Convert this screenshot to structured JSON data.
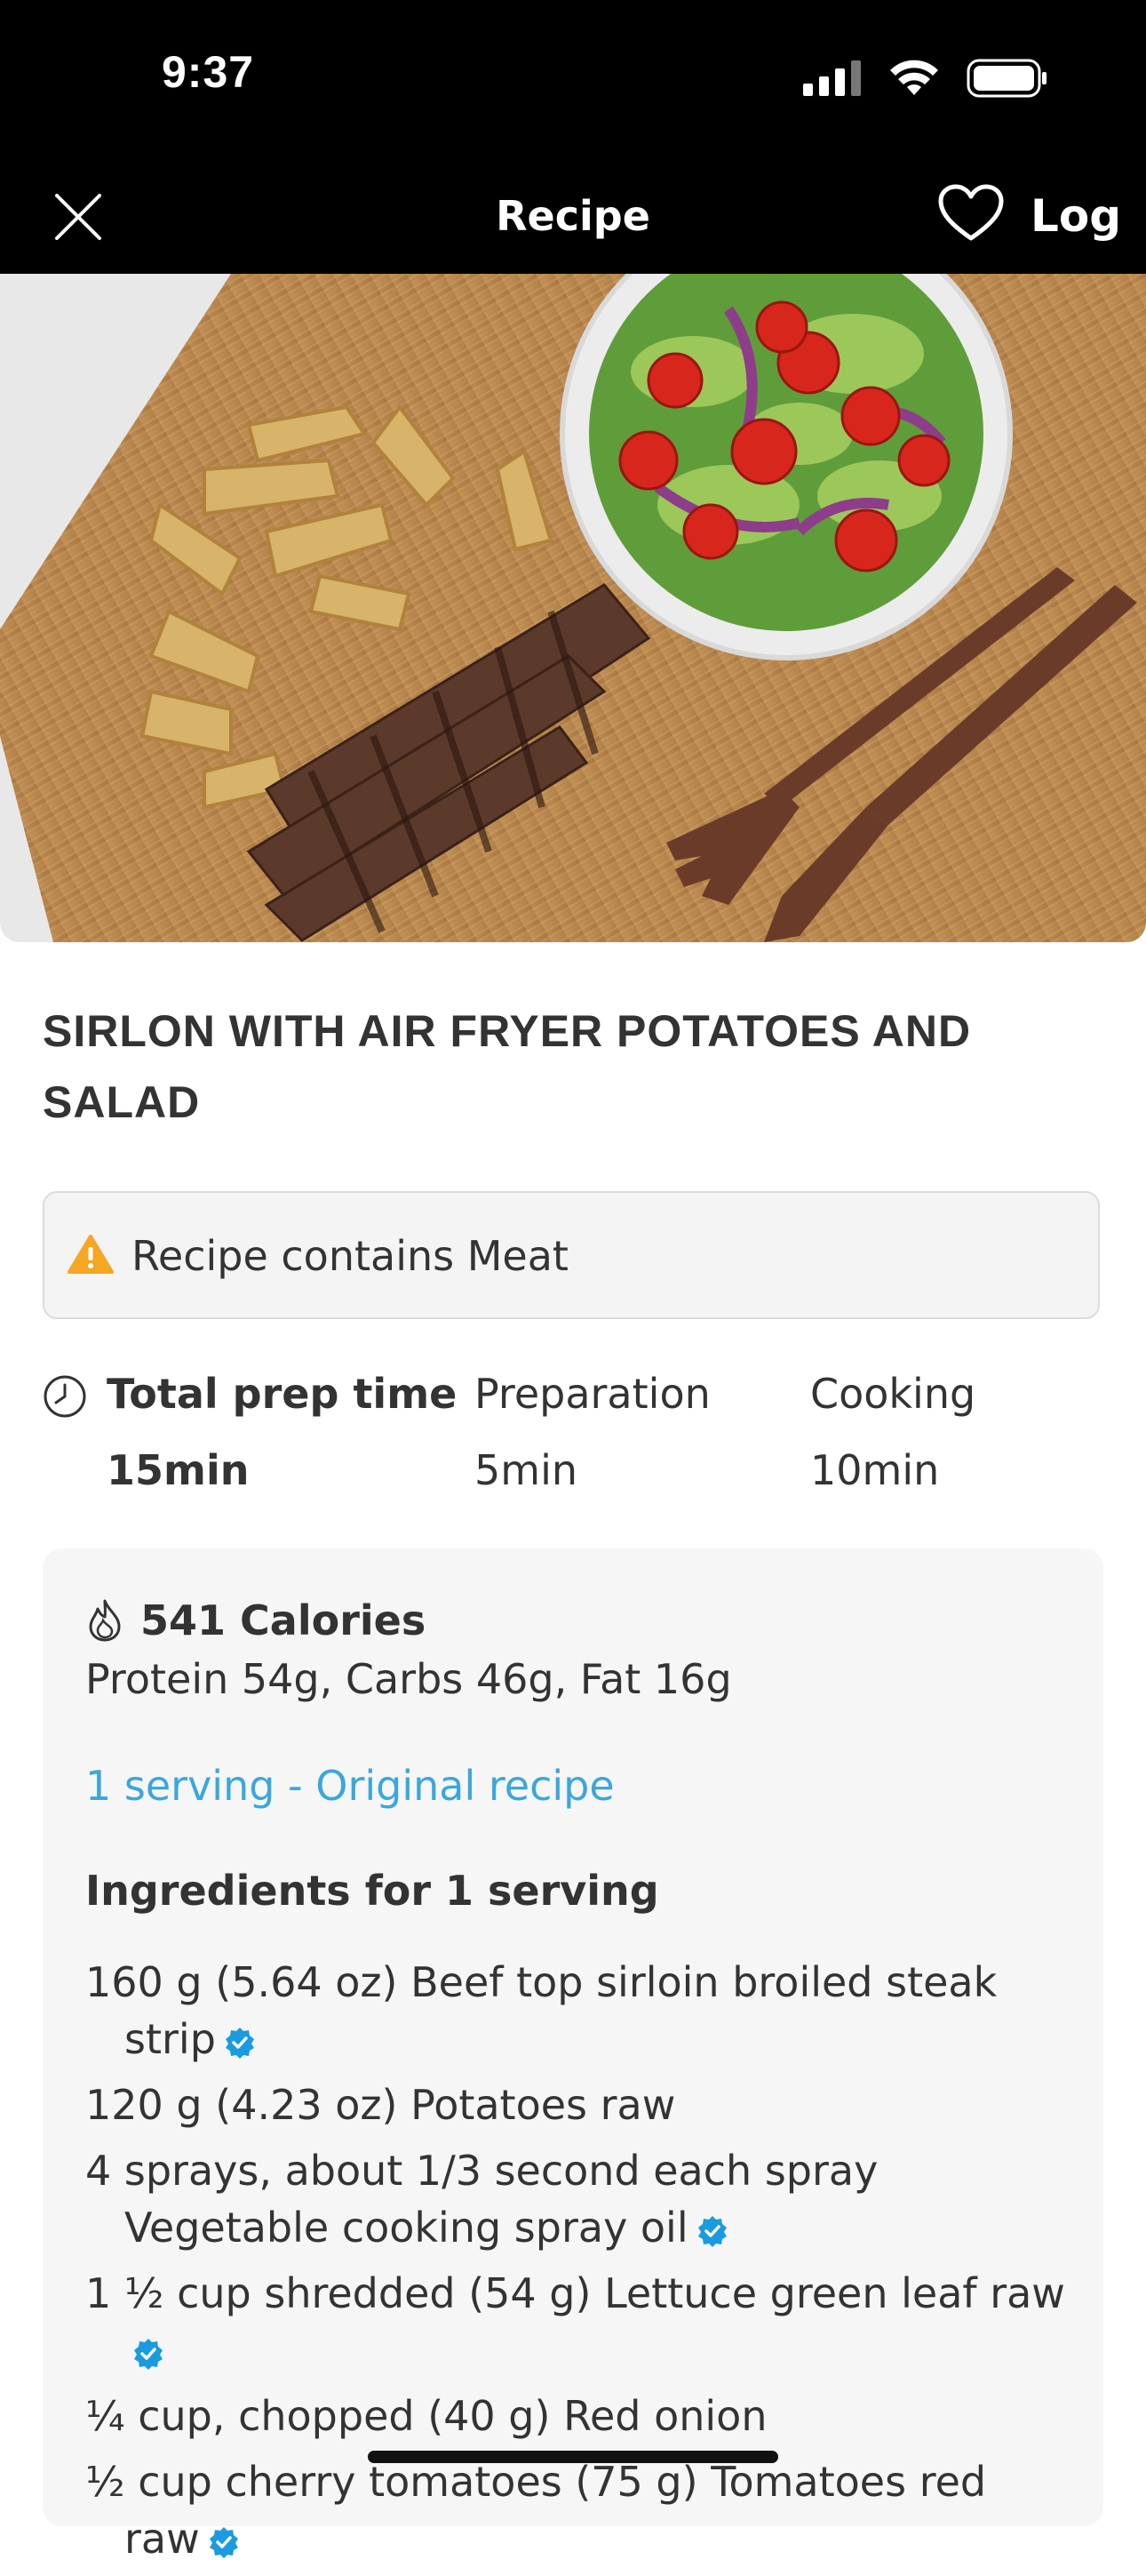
{
  "status_bar": {
    "time": "9:37"
  },
  "nav": {
    "title": "Recipe",
    "log_label": "Log"
  },
  "recipe": {
    "title": "SIRLON WITH AIR FRYER POTATOES AND SALAD",
    "warning": "Recipe contains Meat",
    "prep": {
      "total_label": "Total prep time",
      "total_value": "15min",
      "prep_label": "Preparation",
      "prep_value": "5min",
      "cook_label": "Cooking",
      "cook_value": "10min"
    },
    "nutrition": {
      "calories": "541 Calories",
      "macros": "Protein 54g, Carbs 46g, Fat 16g"
    },
    "serving_link": "1 serving - Original recipe",
    "ingredients_heading": "Ingredients for 1 serving",
    "ingredients": [
      {
        "text": "160 g (5.64 oz) Beef top sirloin broiled steak strip",
        "verified": true
      },
      {
        "text": "120 g (4.23 oz) Potatoes raw",
        "verified": false
      },
      {
        "text": "4 sprays, about 1/3 second each spray Vegetable cooking spray oil",
        "verified": true
      },
      {
        "text": "1 ½ cup shredded (54 g) Lettuce green leaf raw",
        "verified": true
      },
      {
        "text": "¼ cup, chopped (40 g) Red onion",
        "verified": false
      },
      {
        "text": "½ cup cherry tomatoes (75 g) Tomatoes red raw",
        "verified": true
      }
    ]
  },
  "colors": {
    "accent_link": "#3aa7dc",
    "verified_badge": "#1a9be0",
    "warning_icon": "#f5a623"
  }
}
